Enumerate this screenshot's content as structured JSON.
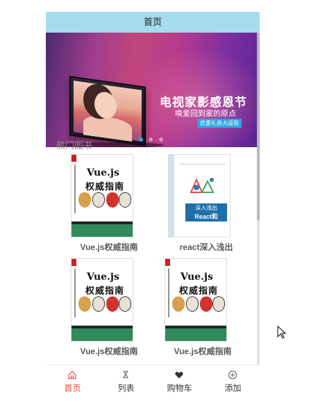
{
  "header": {
    "title": "首页"
  },
  "banner": {
    "title": "电视家影感恩节",
    "subtitle": "唤爱回到家的原点",
    "button_label": "优惠礼券大返现",
    "slide_count": 3,
    "active_slide": 1
  },
  "section": {
    "title": "热门图书"
  },
  "books": [
    {
      "name": "Vue.js权威指南",
      "cover_title_1": "Vue.js",
      "cover_title_2": "权威指南"
    },
    {
      "name": "react深入浅出",
      "cover_title_1": "深入浅出",
      "cover_title_2": "React和Redux"
    },
    {
      "name": "Vue.js权威指南",
      "cover_title_1": "Vue.js",
      "cover_title_2": "权威指南"
    },
    {
      "name": "Vue.js权威指南",
      "cover_title_1": "Vue.js",
      "cover_title_2": "权威指南"
    }
  ],
  "tabbar": {
    "items": [
      {
        "label": "首页",
        "icon": "home-icon",
        "active": true
      },
      {
        "label": "列表",
        "icon": "list-icon",
        "active": false
      },
      {
        "label": "购物车",
        "icon": "heart-icon",
        "active": false
      },
      {
        "label": "添加",
        "icon": "add-circle-icon",
        "active": false
      }
    ]
  },
  "colors": {
    "header_bg": "#a6dced",
    "active_tab": "#e24b3b",
    "banner_button": "#2aa7e6",
    "book_name": "#5b5b5b"
  }
}
